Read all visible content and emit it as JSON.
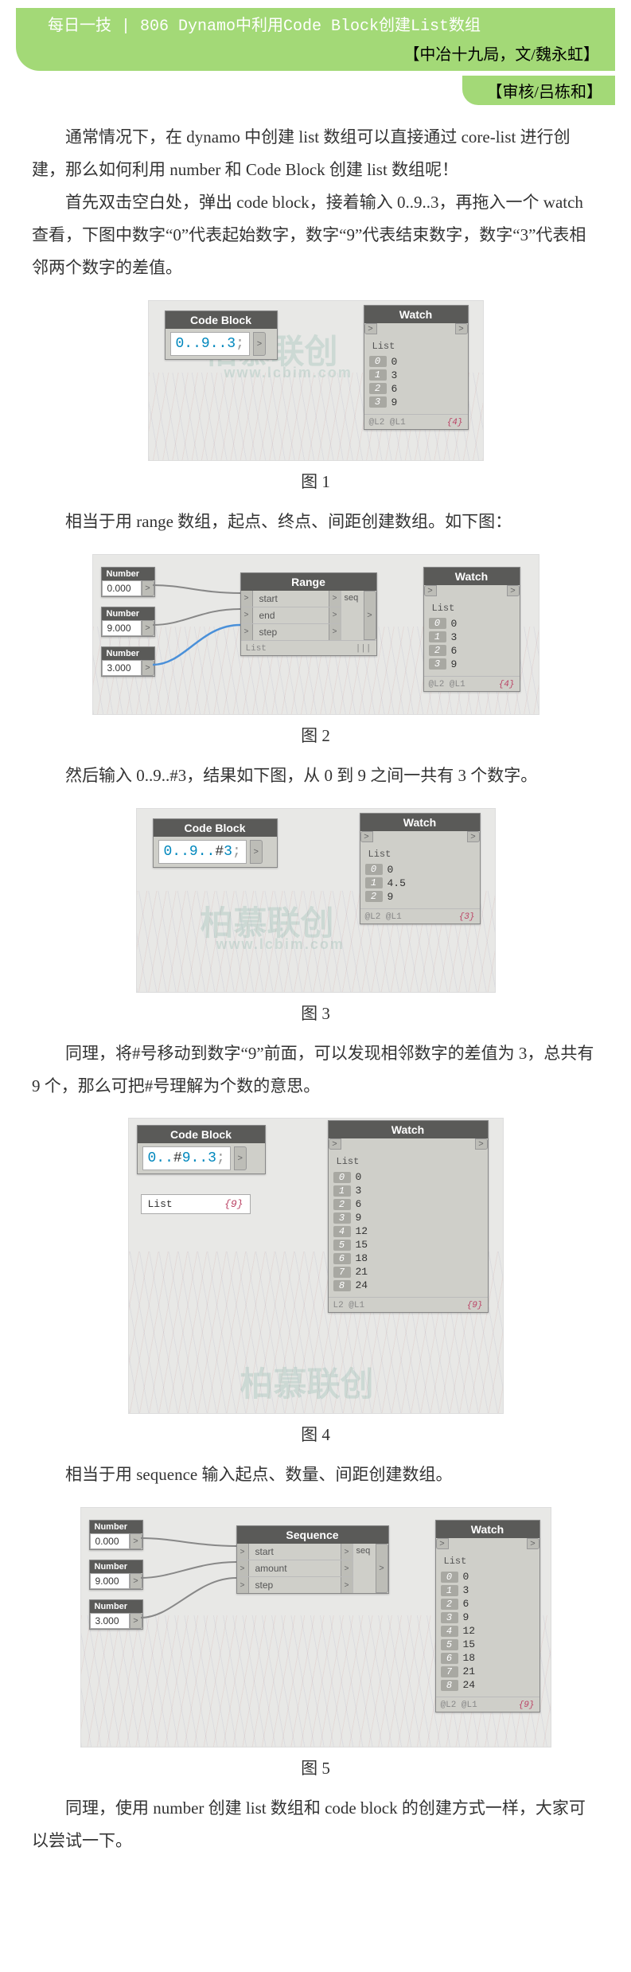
{
  "header": {
    "title": "每日一技 | 806 Dynamo中利用Code Block创建List数组",
    "credit": "【中冶十九局，文/魏永虹】",
    "reviewer": "【审核/吕栋和】"
  },
  "paragraphs": {
    "p1": "通常情况下，在 dynamo 中创建 list 数组可以直接通过 core-list 进行创建，那么如何利用 number 和 Code Block 创建 list 数组呢！",
    "p2": "首先双击空白处，弹出 code block，接着输入 0..9..3，再拖入一个 watch 查看，下图中数字“0”代表起始数字，数字“9”代表结束数字，数字“3”代表相邻两个数字的差值。",
    "p3": "相当于用 range 数组，起点、终点、间距创建数组。如下图：",
    "p4": "然后输入 0..9..#3，结果如下图，从 0 到 9 之间一共有 3 个数字。",
    "p5": "同理，将#号移动到数字“9”前面，可以发现相邻数字的差值为 3，总共有 9 个，那么可把#号理解为个数的意思。",
    "p6": "相当于用 sequence 输入起点、数量、间距创建数组。",
    "p7": "同理，使用 number 创建 list 数组和 code block 的创建方式一样，大家可以尝试一下。"
  },
  "captions": {
    "c1": "图 1",
    "c2": "图 2",
    "c3": "图 3",
    "c4": "图 4",
    "c5": "图 5"
  },
  "nodes": {
    "codeBlockTitle": "Code Block",
    "watchTitle": "Watch",
    "rangeTitle": "Range",
    "sequenceTitle": "Sequence",
    "numberTitle": "Number",
    "listLabel": "List",
    "startLabel": "start",
    "endLabel": "end",
    "stepLabel": "step",
    "amountLabel": "amount",
    "seqLabel": "seq"
  },
  "fig1": {
    "code": "0..9..3",
    "watch": {
      "items": [
        {
          "idx": "0",
          "val": "0"
        },
        {
          "idx": "1",
          "val": "3"
        },
        {
          "idx": "2",
          "val": "6"
        },
        {
          "idx": "3",
          "val": "9"
        }
      ],
      "footerL": "@L2 @L1",
      "footerR": "{4}"
    }
  },
  "fig2": {
    "num1": "0.000",
    "num2": "9.000",
    "num3": "3.000",
    "rangeFooterL": "List",
    "watch": {
      "items": [
        {
          "idx": "0",
          "val": "0"
        },
        {
          "idx": "1",
          "val": "3"
        },
        {
          "idx": "2",
          "val": "6"
        },
        {
          "idx": "3",
          "val": "9"
        }
      ],
      "footerL": "@L2 @L1",
      "footerR": "{4}"
    }
  },
  "fig3": {
    "codePrefix": "0..9..",
    "codeHash": "#",
    "codeSuffix": "3",
    "watch": {
      "items": [
        {
          "idx": "0",
          "val": "0"
        },
        {
          "idx": "1",
          "val": "4.5"
        },
        {
          "idx": "2",
          "val": "9"
        }
      ],
      "footerL": "@L2 @L1",
      "footerR": "{3}"
    }
  },
  "fig4": {
    "codePrefix": "0..",
    "codeHash": "#",
    "codeSuffix": "9..3",
    "extraLabel": "List",
    "extraCount": "{9}",
    "watch": {
      "items": [
        {
          "idx": "0",
          "val": "0"
        },
        {
          "idx": "1",
          "val": "3"
        },
        {
          "idx": "2",
          "val": "6"
        },
        {
          "idx": "3",
          "val": "9"
        },
        {
          "idx": "4",
          "val": "12"
        },
        {
          "idx": "5",
          "val": "15"
        },
        {
          "idx": "6",
          "val": "18"
        },
        {
          "idx": "7",
          "val": "21"
        },
        {
          "idx": "8",
          "val": "24"
        }
      ],
      "footerL": "L2 @L1",
      "footerR": "{9}"
    }
  },
  "fig5": {
    "num1": "0.000",
    "num2": "9.000",
    "num3": "3.000",
    "watch": {
      "items": [
        {
          "idx": "0",
          "val": "0"
        },
        {
          "idx": "1",
          "val": "3"
        },
        {
          "idx": "2",
          "val": "6"
        },
        {
          "idx": "3",
          "val": "9"
        },
        {
          "idx": "4",
          "val": "12"
        },
        {
          "idx": "5",
          "val": "15"
        },
        {
          "idx": "6",
          "val": "18"
        },
        {
          "idx": "7",
          "val": "21"
        },
        {
          "idx": "8",
          "val": "24"
        }
      ],
      "footerL": "@L2 @L1",
      "footerR": "{9}"
    }
  },
  "watermark": {
    "brand": "柏慕联创",
    "url": "www.lcbim.com"
  }
}
